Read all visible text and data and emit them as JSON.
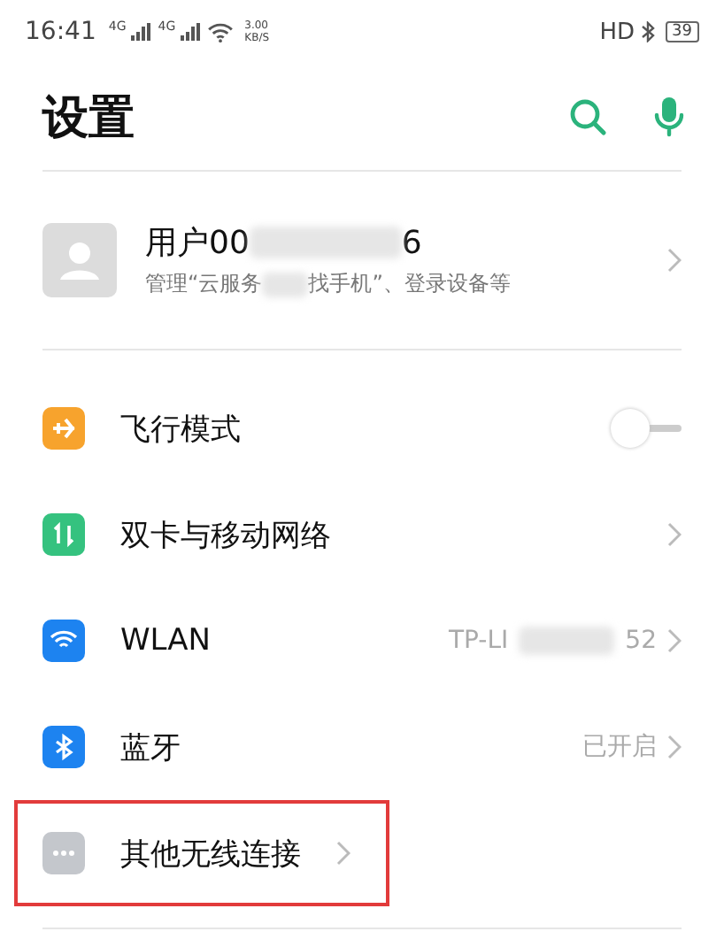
{
  "status_bar": {
    "time": "16:41",
    "signal_1": "4G",
    "signal_2": "4G",
    "speed": "3.00",
    "speed_unit": "KB/S",
    "hd": "HD",
    "battery": "39"
  },
  "header": {
    "title": "设置"
  },
  "account": {
    "name_start": "用户00",
    "name_end": "6",
    "subtitle_start": "管理“云服务",
    "subtitle_end": "找手机”、登录设备等"
  },
  "items": [
    {
      "kind": "toggle",
      "label": "飞行模式",
      "on": false,
      "color": "#f7a32d",
      "highlighted": false
    },
    {
      "kind": "link",
      "label": "双卡与移动网络",
      "color": "#35c27f",
      "highlighted": false
    },
    {
      "kind": "link",
      "label": "WLAN",
      "value_start": "TP-LI",
      "value_end": "52",
      "color": "#1d83f0",
      "highlighted": false
    },
    {
      "kind": "link",
      "label": "蓝牙",
      "value_start": "已开启",
      "color": "#1d83f0",
      "highlighted": false
    },
    {
      "kind": "link",
      "label": "其他无线连接",
      "color": "#c4c7cc",
      "highlighted": true
    }
  ]
}
